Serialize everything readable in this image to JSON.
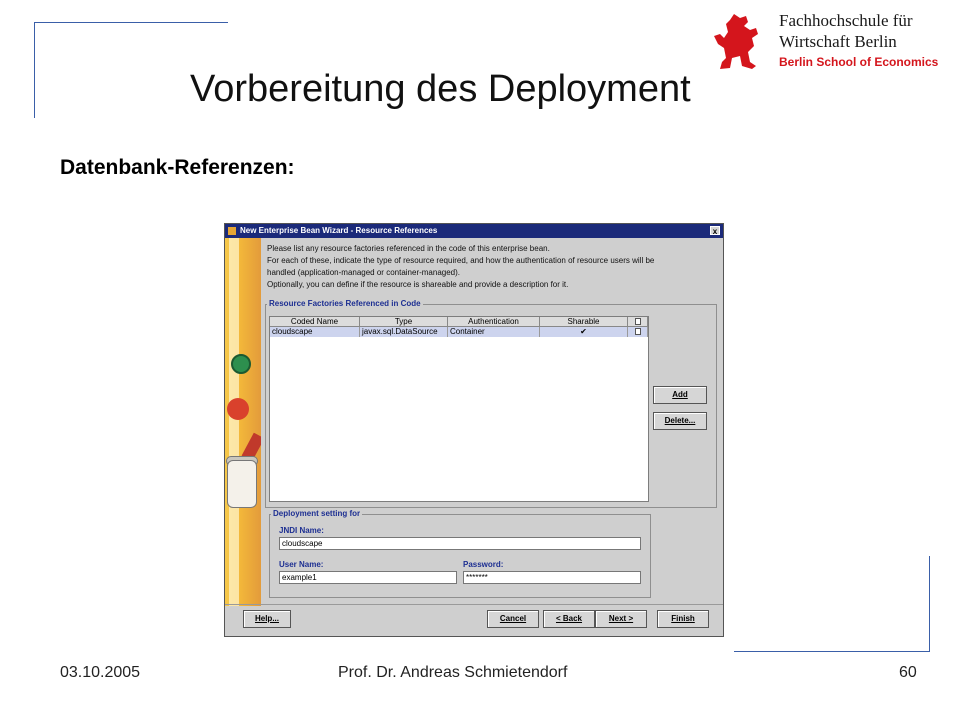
{
  "slide": {
    "title": "Vorbereitung des Deployment",
    "subtitle": "Datenbank-Referenzen:"
  },
  "logo": {
    "line1": "Fachhochschule für",
    "line2": "Wirtschaft Berlin",
    "line3": "Berlin School of Economics",
    "icon": "berlin-bear-icon",
    "accent": "#d4151c"
  },
  "footer": {
    "date": "03.10.2005",
    "author": "Prof. Dr. Andreas Schmietendorf",
    "page": "60"
  },
  "dialog": {
    "title": "New Enterprise Bean Wizard - Resource References",
    "close_label": "x",
    "instructions": [
      "Please list any resource factories referenced in the code of this enterprise bean.",
      "For each of these, indicate the type of resource required, and how the authentication of resource users will be",
      "handled (application-managed or container-managed).",
      "Optionally, you can define if the resource is shareable and provide a description for it."
    ],
    "group_label": "Resource Factories Referenced in Code",
    "table": {
      "columns": [
        "Coded Name",
        "Type",
        "Authentication",
        "Sharable"
      ],
      "rows": [
        {
          "coded_name": "cloudscape",
          "type": "javax.sql.DataSource",
          "authentication": "Container",
          "sharable": "✔"
        }
      ]
    },
    "buttons": {
      "add": "Add",
      "delete": "Delete...",
      "help": "Help...",
      "cancel": "Cancel",
      "back": "< Back",
      "next": "Next >",
      "finish": "Finish"
    },
    "deployment": {
      "group_label": "Deployment setting for",
      "jndi_label": "JNDI Name:",
      "jndi_value": "cloudscape",
      "user_label": "User Name:",
      "user_value": "example1",
      "password_label": "Password:",
      "password_value": "*******"
    },
    "colors": {
      "titlebar": "#1b2a7a",
      "label": "#1d2f92",
      "selected_row": "#cdd4ee"
    }
  }
}
